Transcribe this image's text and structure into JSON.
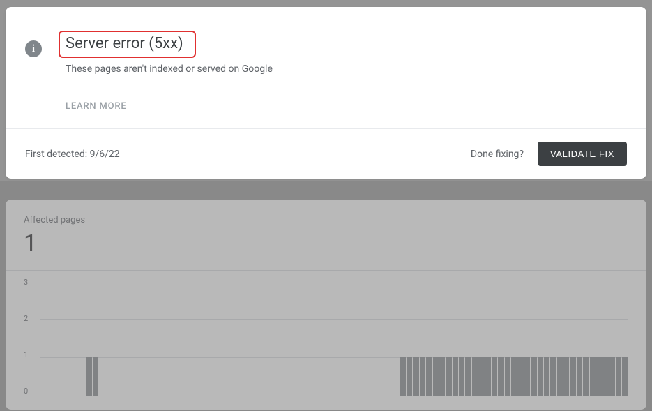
{
  "header": {
    "title": "Server error (5xx)",
    "subtitle": "These pages aren't indexed or served on Google",
    "learn_more": "LEARN MORE"
  },
  "footer": {
    "first_detected_label": "First detected: ",
    "first_detected_date": "9/6/22",
    "done_fixing": "Done fixing?",
    "validate_fix": "VALIDATE FIX"
  },
  "chart": {
    "label": "Affected pages",
    "value": "1"
  },
  "chart_data": {
    "type": "bar",
    "title": "Affected pages",
    "ylabel": "",
    "ylim": [
      0,
      3
    ],
    "y_ticks": [
      3,
      2,
      1,
      0
    ],
    "values": [
      0,
      0,
      0,
      0,
      0,
      0,
      0,
      1,
      1,
      0,
      0,
      0,
      0,
      0,
      0,
      0,
      0,
      0,
      0,
      0,
      0,
      0,
      0,
      0,
      0,
      0,
      0,
      0,
      0,
      0,
      0,
      0,
      0,
      0,
      0,
      0,
      0,
      0,
      0,
      0,
      0,
      0,
      0,
      0,
      0,
      0,
      0,
      0,
      0,
      0,
      0,
      0,
      0,
      0,
      0,
      1,
      1,
      1,
      1,
      1,
      1,
      1,
      1,
      1,
      1,
      1,
      1,
      1,
      1,
      1,
      1,
      1,
      1,
      1,
      1,
      1,
      1,
      1,
      1,
      1,
      1,
      1,
      1,
      1,
      1,
      1,
      1,
      1,
      1,
      1
    ]
  }
}
